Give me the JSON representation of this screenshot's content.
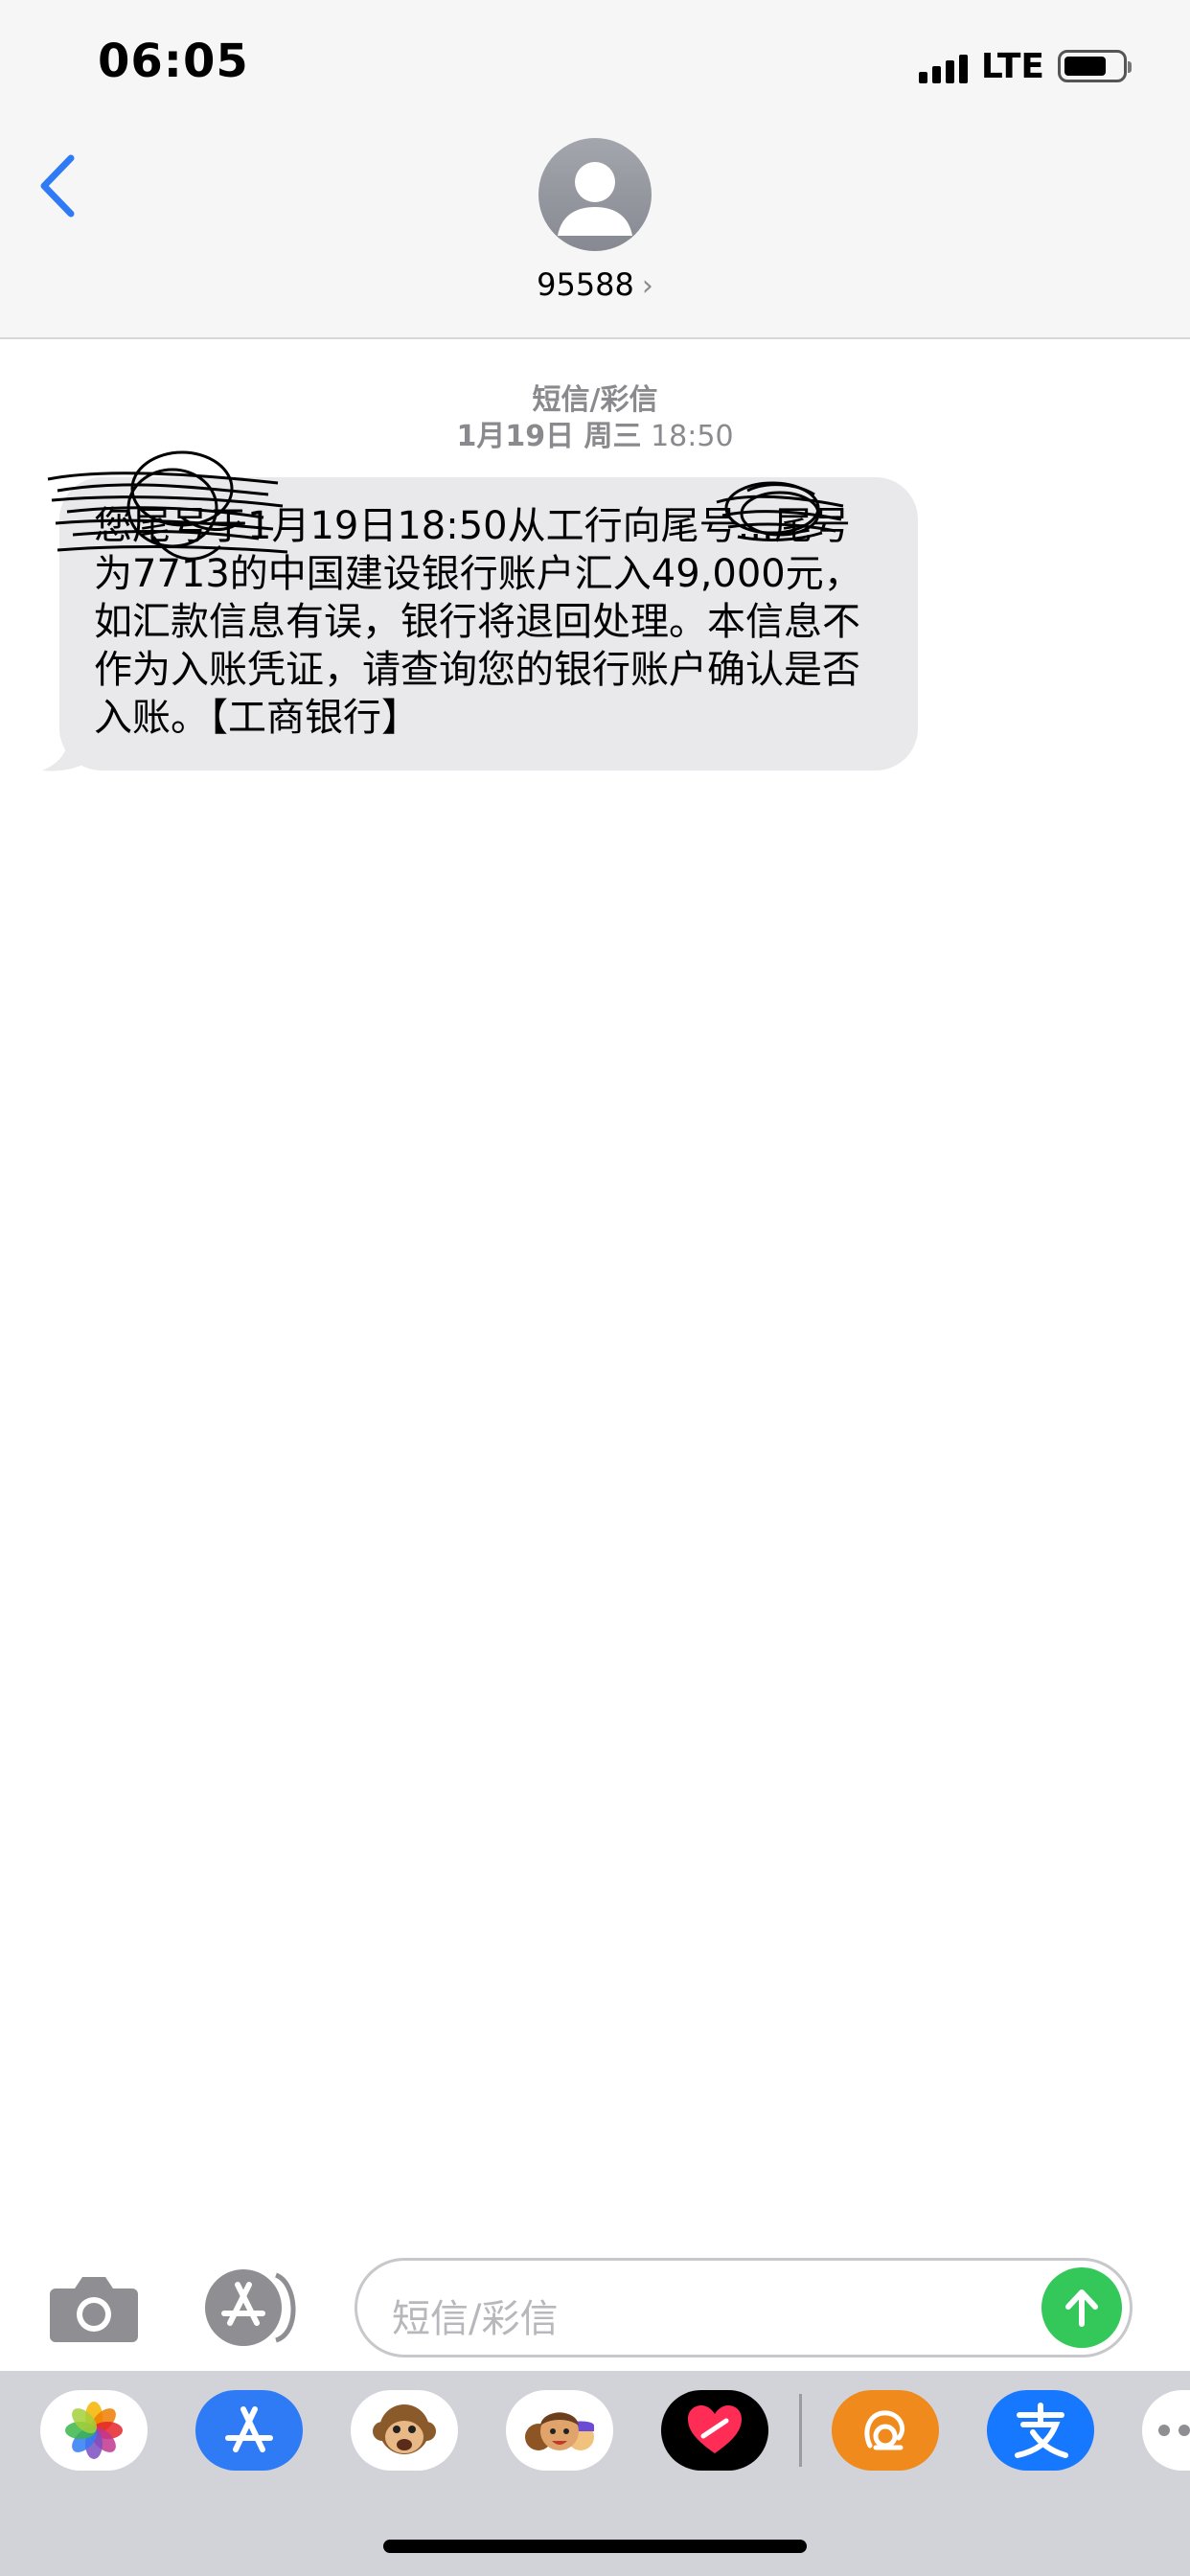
{
  "status_bar": {
    "time": "06:05",
    "network": "LTE"
  },
  "header": {
    "contact": "95588",
    "chevron": "›",
    "avatar_icon": "person-icon",
    "back_icon": "chevron-left-icon"
  },
  "thread": {
    "message_type": "短信/彩信",
    "date": "1月19日 周三",
    "time": "18:50",
    "messages": [
      {
        "direction": "incoming",
        "text": "您尾号于1月19日18:50从工行向尾号...尾号为7713的中国建设银行账户汇入49,000元，如汇款信息有误，银行将退回处理。本信息不作为入账凭证，请查询您的银行账户确认是否入账。【工商银行】"
      }
    ]
  },
  "compose": {
    "placeholder": "短信/彩信",
    "send_icon": "arrow-up-icon",
    "camera_icon": "camera-icon",
    "apps_icon": "app-store-icon"
  },
  "app_drawer": {
    "apps": [
      "photos",
      "app-store",
      "animoji",
      "memoji",
      "digital-touch",
      "uc-browser",
      "alipay",
      "more"
    ]
  },
  "colors": {
    "accent": "#2f7bf5",
    "send": "#34c759",
    "bubble": "#e9e9eb",
    "meta": "#8a8a8e"
  }
}
